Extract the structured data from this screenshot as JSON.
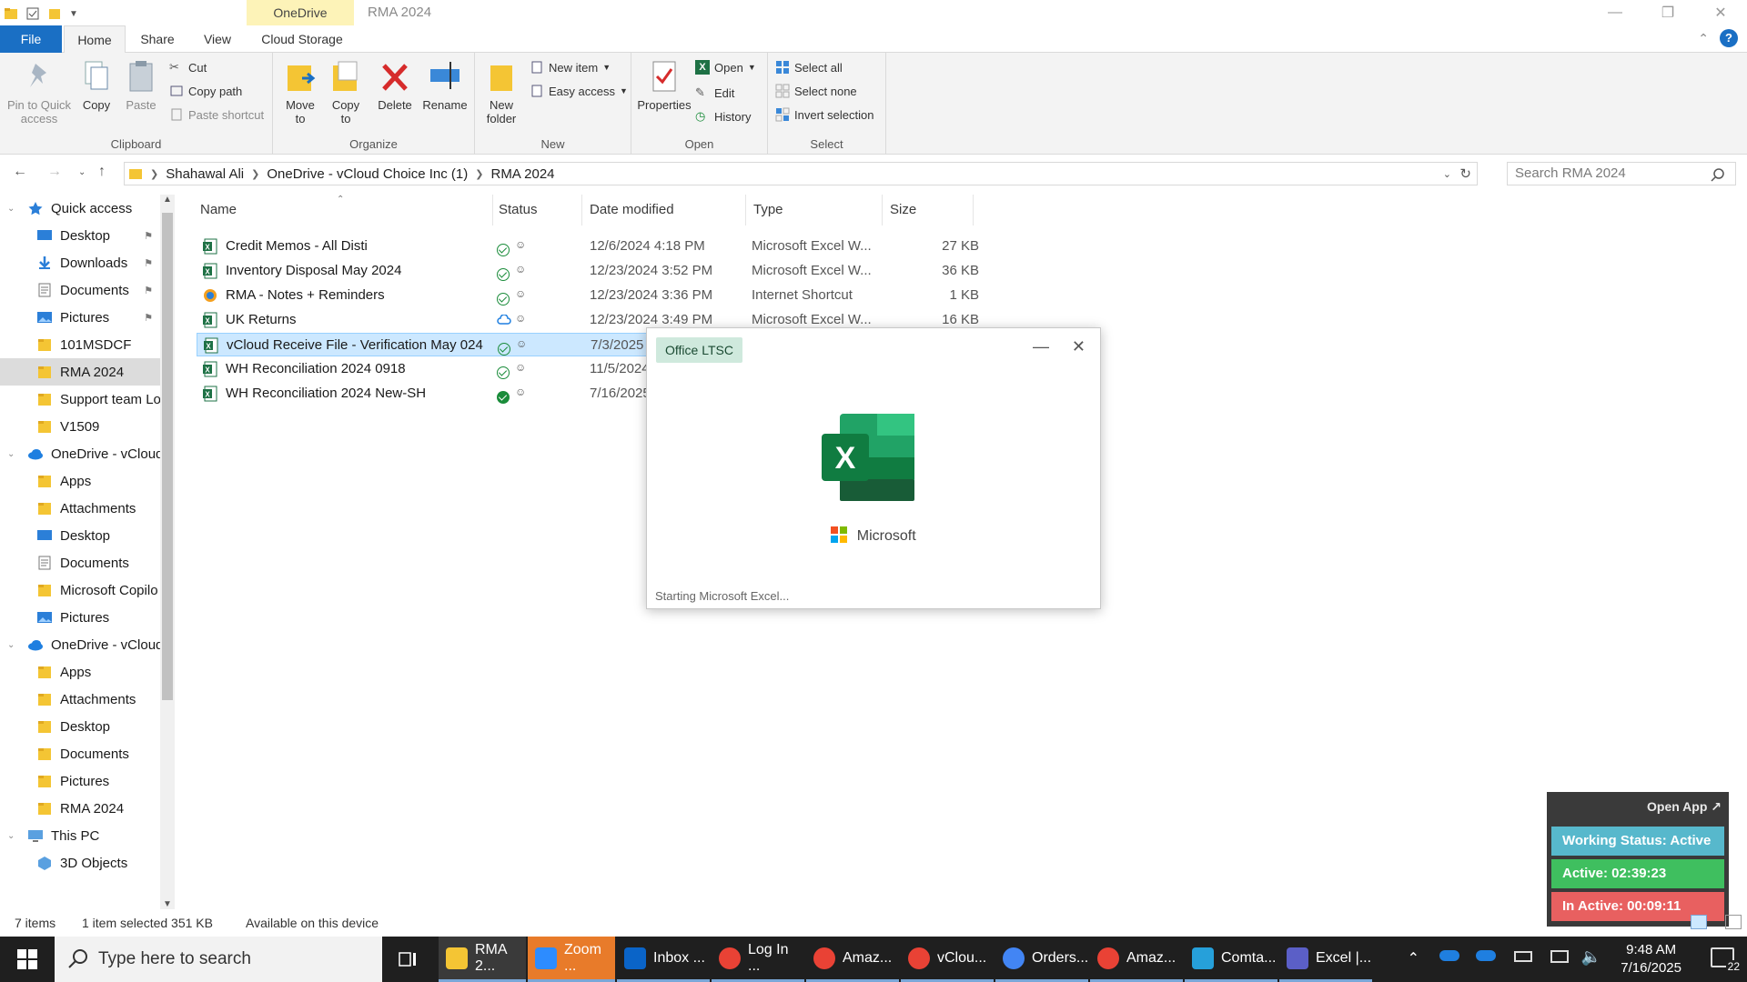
{
  "window": {
    "title": "RMA 2024",
    "context_tab": "OneDrive",
    "min": "—",
    "restore": "❐",
    "close": "✕"
  },
  "tabs": {
    "file": "File",
    "home": "Home",
    "share": "Share",
    "view": "View",
    "cloud": "Cloud Storage",
    "collapse": "⌃",
    "help": "?"
  },
  "ribbon": {
    "clipboard": {
      "label": "Clipboard",
      "pin": "Pin to Quick access",
      "copy": "Copy",
      "paste": "Paste",
      "cut": "Cut",
      "copy_path": "Copy path",
      "paste_shortcut": "Paste shortcut"
    },
    "organize": {
      "label": "Organize",
      "move_to": "Move to",
      "copy_to": "Copy to",
      "delete": "Delete",
      "rename": "Rename"
    },
    "new": {
      "label": "New",
      "new_folder": "New folder",
      "new_item": "New item",
      "easy_access": "Easy access"
    },
    "open": {
      "label": "Open",
      "properties": "Properties",
      "open": "Open",
      "edit": "Edit",
      "history": "History"
    },
    "select": {
      "label": "Select",
      "select_all": "Select all",
      "select_none": "Select none",
      "invert": "Invert selection"
    }
  },
  "address": {
    "crumbs": [
      "Shahawal Ali",
      "OneDrive - vCloud Choice Inc (1)",
      "RMA 2024"
    ],
    "search_placeholder": "Search RMA 2024"
  },
  "nav": [
    {
      "label": "Quick access",
      "icon": "star-icon",
      "level": 0,
      "chevron": "⌄"
    },
    {
      "label": "Desktop",
      "icon": "desktop-icon",
      "level": 1,
      "pinned": true
    },
    {
      "label": "Downloads",
      "icon": "download-icon",
      "level": 1,
      "pinned": true
    },
    {
      "label": "Documents",
      "icon": "documents-icon",
      "level": 1,
      "pinned": true
    },
    {
      "label": "Pictures",
      "icon": "pictures-icon",
      "level": 1,
      "pinned": true
    },
    {
      "label": "101MSDCF",
      "icon": "folder-icon",
      "level": 1
    },
    {
      "label": "RMA 2024",
      "icon": "folder-icon",
      "level": 1,
      "selected": true
    },
    {
      "label": "Support team Lo",
      "icon": "folder-icon",
      "level": 1
    },
    {
      "label": "V1509",
      "icon": "folder-icon",
      "level": 1
    },
    {
      "label": "OneDrive - vCloud",
      "icon": "cloud-icon",
      "level": 0,
      "chevron": "⌄"
    },
    {
      "label": "Apps",
      "icon": "folder-icon",
      "level": 1
    },
    {
      "label": "Attachments",
      "icon": "folder-icon",
      "level": 1
    },
    {
      "label": "Desktop",
      "icon": "desktop-icon",
      "level": 1
    },
    {
      "label": "Documents",
      "icon": "documents-icon",
      "level": 1
    },
    {
      "label": "Microsoft Copilo",
      "icon": "folder-icon",
      "level": 1
    },
    {
      "label": "Pictures",
      "icon": "pictures-icon",
      "level": 1
    },
    {
      "label": "OneDrive - vCloud",
      "icon": "cloud-icon",
      "level": 0,
      "chevron": "⌄"
    },
    {
      "label": "Apps",
      "icon": "folder-icon",
      "level": 1
    },
    {
      "label": "Attachments",
      "icon": "folder-icon",
      "level": 1
    },
    {
      "label": "Desktop",
      "icon": "folder-icon",
      "level": 1
    },
    {
      "label": "Documents",
      "icon": "folder-icon",
      "level": 1
    },
    {
      "label": "Pictures",
      "icon": "folder-icon",
      "level": 1
    },
    {
      "label": "RMA 2024",
      "icon": "folder-icon",
      "level": 1
    },
    {
      "label": "This PC",
      "icon": "pc-icon",
      "level": 0,
      "chevron": "⌄"
    },
    {
      "label": "3D Objects",
      "icon": "3d-objects-icon",
      "level": 1
    }
  ],
  "columns": {
    "name": "Name",
    "status": "Status",
    "date": "Date modified",
    "type": "Type",
    "size": "Size"
  },
  "files": [
    {
      "name": "Credit Memos - All Disti",
      "status": "ok",
      "date": "12/6/2024 4:18 PM",
      "type": "Microsoft Excel W...",
      "size": "27 KB",
      "icon": "excel-file-icon"
    },
    {
      "name": "Inventory Disposal May 2024",
      "status": "ok",
      "date": "12/23/2024 3:52 PM",
      "type": "Microsoft Excel W...",
      "size": "36 KB",
      "icon": "excel-file-icon"
    },
    {
      "name": "RMA - Notes + Reminders",
      "status": "ok",
      "date": "12/23/2024 3:36 PM",
      "type": "Internet Shortcut",
      "size": "1 KB",
      "icon": "internet-shortcut-icon"
    },
    {
      "name": "UK Returns",
      "status": "cloud",
      "date": "12/23/2024 3:49 PM",
      "type": "Microsoft Excel W...",
      "size": "16 KB",
      "icon": "excel-file-icon"
    },
    {
      "name": "vCloud Receive File - Verification May 024",
      "status": "ok",
      "date": "7/3/2025",
      "type": "",
      "size": "",
      "icon": "excel-file-icon",
      "selected": true
    },
    {
      "name": "WH Reconciliation 2024 0918",
      "status": "ok",
      "date": "11/5/2024",
      "type": "",
      "size": "",
      "icon": "excel-file-icon"
    },
    {
      "name": "WH Reconciliation 2024 New-SH",
      "status": "full",
      "date": "7/16/2025",
      "type": "",
      "size": "",
      "icon": "excel-file-icon"
    }
  ],
  "splash": {
    "badge": "Office LTSC",
    "brand": "Microsoft",
    "status": "Starting Microsoft Excel...",
    "min": "—",
    "close": "✕"
  },
  "tracker": {
    "open_app": "Open App ↗",
    "working": "Working Status: Active",
    "active": "Active: 02:39:23",
    "inactive": "In Active: 00:09:11"
  },
  "status": {
    "items": "7 items",
    "selected": "1 item selected  351 KB",
    "availability": "Available on this device"
  },
  "taskbar": {
    "search_placeholder": "Type here to search",
    "tasks": [
      {
        "label": "RMA 2...",
        "icon": "file-explorer-icon",
        "color": "#f4c534",
        "active": true
      },
      {
        "label": "Zoom ...",
        "icon": "zoom-icon",
        "color": "#2d8cff",
        "zoom": true
      },
      {
        "label": "Inbox ...",
        "icon": "outlook-icon",
        "color": "#0a64c8"
      },
      {
        "label": "Log In ...",
        "icon": "chrome-icon",
        "color": "#e94235"
      },
      {
        "label": "Amaz...",
        "icon": "chrome-icon",
        "color": "#e94235"
      },
      {
        "label": "vClou...",
        "icon": "chrome-icon",
        "color": "#e94235"
      },
      {
        "label": "Orders...",
        "icon": "chrome-icon",
        "color": "#4285f4"
      },
      {
        "label": "Amaz...",
        "icon": "chrome-icon",
        "color": "#e94235"
      },
      {
        "label": "Comta...",
        "icon": "comtrade-icon",
        "color": "#26a0da"
      },
      {
        "label": "Excel |...",
        "icon": "teams-icon",
        "color": "#5b5fc7"
      }
    ],
    "time": "9:48 AM",
    "date": "7/16/2025",
    "notifications": "22"
  }
}
